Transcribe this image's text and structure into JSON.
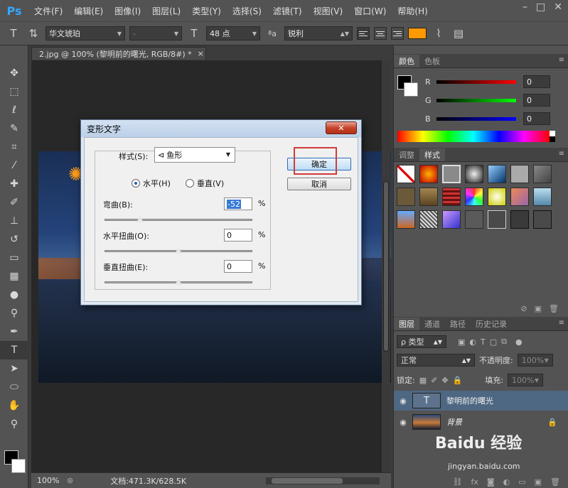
{
  "app": {
    "logo": "Ps",
    "menu": [
      "文件(F)",
      "编辑(E)",
      "图像(I)",
      "图层(L)",
      "类型(Y)",
      "选择(S)",
      "滤镜(T)",
      "视图(V)",
      "窗口(W)",
      "帮助(H)"
    ],
    "window_controls": [
      "–",
      "□",
      "✕"
    ]
  },
  "options_bar": {
    "font_family": "华文琥珀",
    "font_style": "-",
    "font_size": "48 点",
    "antialias": "锐利",
    "text_color": "#ff9900"
  },
  "document": {
    "tab_title": "2.jpg @ 100% (黎明前的曙光, RGB/8#) *",
    "tab_close": "×"
  },
  "status": {
    "zoom": "100%",
    "doc_info": "文档:471.3K/628.5K"
  },
  "color_panel": {
    "tabs": [
      "颜色",
      "色板"
    ],
    "channels": [
      {
        "label": "R",
        "value": "0"
      },
      {
        "label": "G",
        "value": "0"
      },
      {
        "label": "B",
        "value": "0"
      }
    ]
  },
  "styles_panel": {
    "tabs": [
      "调整",
      "样式"
    ]
  },
  "layers_panel": {
    "tabs": [
      "图层",
      "通道",
      "路径",
      "历史记录"
    ],
    "filter_kind": "ρ 类型",
    "blend_mode": "正常",
    "opacity_label": "不透明度:",
    "opacity_value": "100%",
    "lock_label": "锁定:",
    "fill_label": "填充:",
    "fill_value": "100%",
    "layers": [
      {
        "name": "黎明前的曙光",
        "thumb": "T"
      },
      {
        "name": "背景",
        "thumb": ""
      }
    ]
  },
  "dialog": {
    "title": "变形文字",
    "close_label": "✕",
    "style_label": "样式(S):",
    "style_value": "鱼形",
    "horizontal_label": "水平(H)",
    "vertical_label": "垂直(V)",
    "bend_label": "弯曲(B):",
    "bend_value": "-52",
    "hdist_label": "水平扭曲(O):",
    "hdist_value": "0",
    "vdist_label": "垂直扭曲(E):",
    "vdist_value": "0",
    "percent": "%",
    "ok_label": "确定",
    "cancel_label": "取消"
  },
  "watermark": {
    "brand": "Baidu 经验",
    "url": "jingyan.baidu.com"
  }
}
